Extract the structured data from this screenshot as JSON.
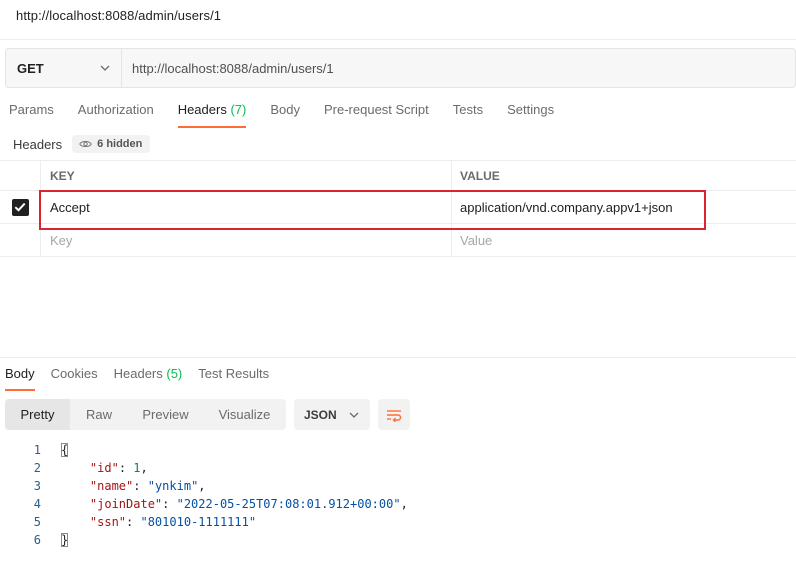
{
  "request": {
    "title": "http://localhost:8088/admin/users/1",
    "method": "GET",
    "url": "http://localhost:8088/admin/users/1"
  },
  "request_tabs": [
    {
      "label": "Params"
    },
    {
      "label": "Authorization"
    },
    {
      "label": "Headers",
      "count": "(7)"
    },
    {
      "label": "Body"
    },
    {
      "label": "Pre-request Script"
    },
    {
      "label": "Tests"
    },
    {
      "label": "Settings"
    }
  ],
  "headers_section": {
    "label": "Headers",
    "hidden_label": "6 hidden"
  },
  "headers_table": {
    "columns": [
      "KEY",
      "VALUE"
    ],
    "rows": [
      {
        "checked": true,
        "key": "Accept",
        "value": "application/vnd.company.appv1+json"
      }
    ],
    "key_placeholder": "Key",
    "value_placeholder": "Value"
  },
  "response_tabs": [
    {
      "label": "Body"
    },
    {
      "label": "Cookies"
    },
    {
      "label": "Headers",
      "count": "(5)"
    },
    {
      "label": "Test Results"
    }
  ],
  "view_modes": [
    "Pretty",
    "Raw",
    "Preview",
    "Visualize"
  ],
  "format": "JSON",
  "code": {
    "line_numbers": [
      "1",
      "2",
      "3",
      "4",
      "5",
      "6"
    ],
    "open_brace": "{",
    "close_brace": "}",
    "fields": [
      {
        "key": "\"id\"",
        "sep": ": ",
        "value": "1",
        "type": "number",
        "trail": ","
      },
      {
        "key": "\"name\"",
        "sep": ": ",
        "value": "\"ynkim\"",
        "type": "string",
        "trail": ","
      },
      {
        "key": "\"joinDate\"",
        "sep": ": ",
        "value": "\"2022-05-25T07:08:01.912+00:00\"",
        "type": "string",
        "trail": ","
      },
      {
        "key": "\"ssn\"",
        "sep": ": ",
        "value": "\"801010-1111111\"",
        "type": "string",
        "trail": ""
      }
    ]
  },
  "colors": {
    "accent": "#ff6c37",
    "count_green": "#0cbb52",
    "highlight_red": "#d9252f"
  }
}
